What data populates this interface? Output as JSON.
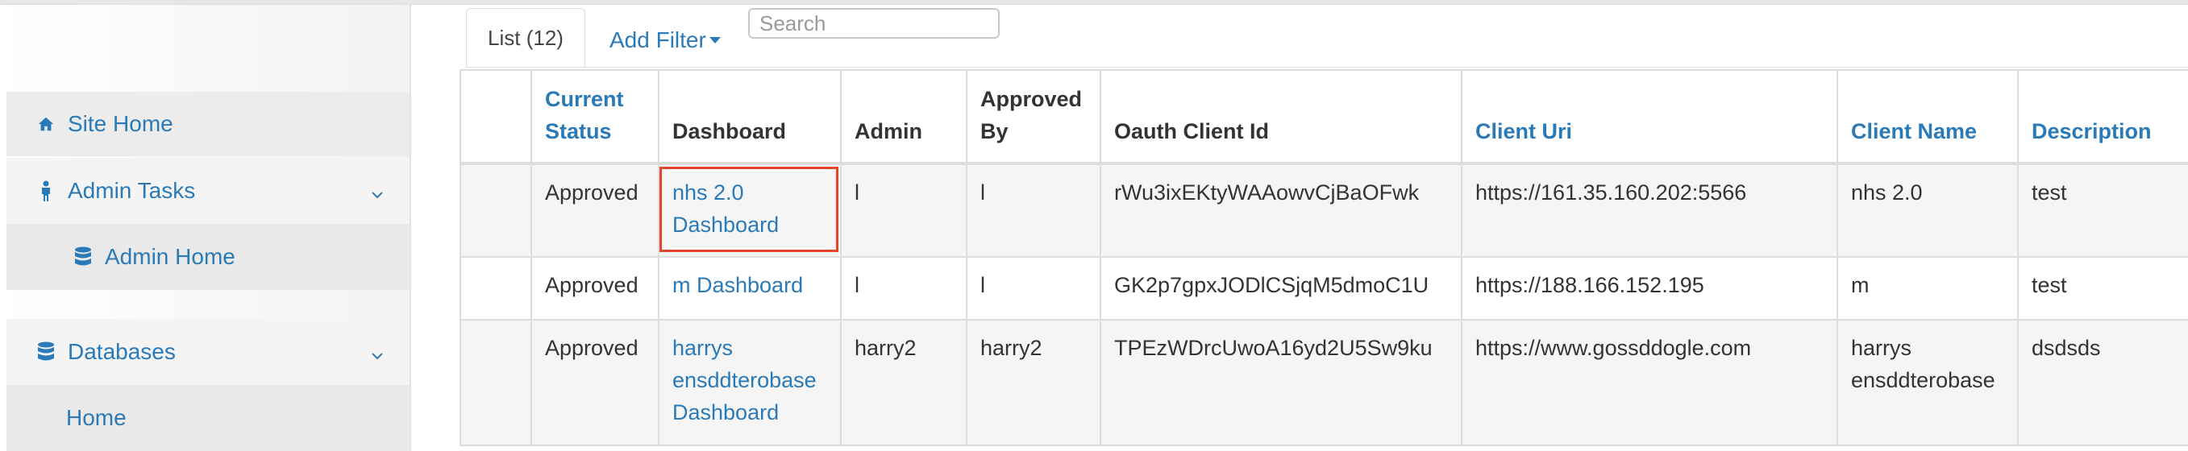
{
  "sidebar": {
    "items": [
      {
        "label": "Site Home",
        "icon": "home-icon"
      },
      {
        "label": "Admin Tasks",
        "icon": "person-icon",
        "expandable": true
      },
      {
        "label": "Admin Home",
        "icon": "database-icon"
      },
      {
        "label": "Databases",
        "icon": "database-icon",
        "expandable": true
      },
      {
        "label": "Home"
      }
    ]
  },
  "tabs": {
    "list_label": "List (12)",
    "add_filter_label": "Add Filter"
  },
  "search": {
    "placeholder": "Search",
    "value": ""
  },
  "table": {
    "columns": [
      "",
      "Current Status",
      "Dashboard",
      "Admin",
      "Approved By",
      "Oauth Client Id",
      "Client Uri",
      "Client Name",
      "Description"
    ],
    "rows": [
      {
        "status": "Approved",
        "dashboard": "nhs 2.0 Dashboard",
        "admin": "l",
        "approved_by": "l",
        "oauth_client_id": "rWu3ixEKtyWAAowvCjBaOFwk",
        "client_uri": "https://161.35.160.202:5566",
        "client_name": "nhs 2.0",
        "description": "test"
      },
      {
        "status": "Approved",
        "dashboard": "m Dashboard",
        "admin": "l",
        "approved_by": "l",
        "oauth_client_id": "GK2p7gpxJODlCSjqM5dmoC1U",
        "client_uri": "https://188.166.152.195",
        "client_name": "m",
        "description": "test"
      },
      {
        "status": "Approved",
        "dashboard": "harrys ensddterobase Dashboard",
        "admin": "harry2",
        "approved_by": "harry2",
        "oauth_client_id": "TPEzWDrcUwoA16yd2U5Sw9ku",
        "client_uri": "https://www.gossddogle.com",
        "client_name": "harrys ensddterobase",
        "description": "dsdsds"
      }
    ]
  },
  "colors": {
    "link": "#2a7ab8",
    "highlight": "#e2452b"
  }
}
